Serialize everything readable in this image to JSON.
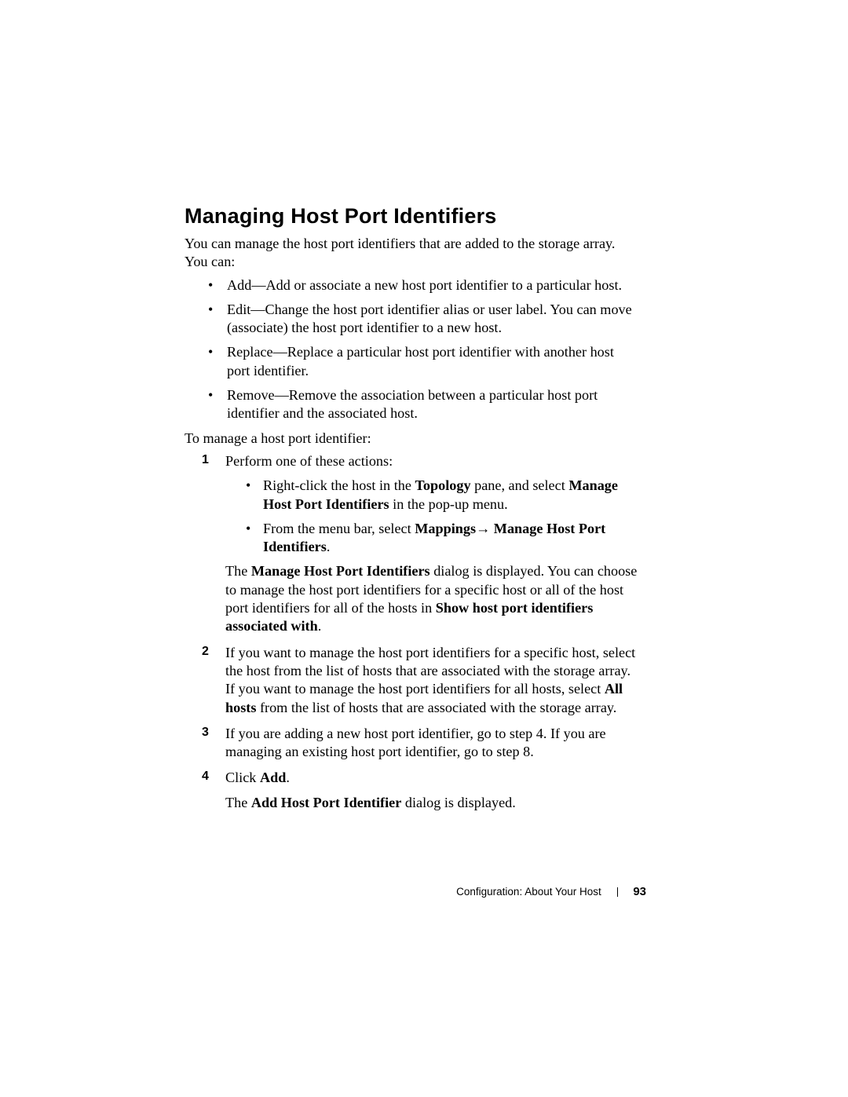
{
  "heading": "Managing Host Port Identifiers",
  "intro": "You can manage the host port identifiers that are added to the storage array. You can:",
  "bullets": [
    "Add—Add or associate a new host port identifier to a particular host.",
    "Edit—Change the host port identifier alias or user label. You can move (associate) the host port identifier to a new host.",
    "Replace—Replace a particular host port identifier with another host port identifier.",
    "Remove—Remove the association between a particular host port identifier and the associated host."
  ],
  "lead2": "To manage a host port identifier:",
  "steps": {
    "s1": {
      "num": "1",
      "text": "Perform one of these actions:",
      "sub_a_pre": "Right-click the host in the ",
      "sub_a_b1": "Topology",
      "sub_a_mid": " pane, and select ",
      "sub_a_b2": "Manage Host Port Identifiers",
      "sub_a_post": " in the pop-up menu.",
      "sub_b_pre": "From the menu bar, select ",
      "sub_b_b1": "Mappings",
      "sub_b_arrow": "→ ",
      "sub_b_b2": "Manage Host Port Identifiers",
      "sub_b_post": ".",
      "para_pre": "The ",
      "para_b1": "Manage Host Port Identifiers",
      "para_mid": " dialog is displayed. You can choose to manage the host port identifiers for a specific host or all of the host port identifiers for all of the hosts in ",
      "para_b2": "Show host port identifiers associated with",
      "para_post": "."
    },
    "s2": {
      "num": "2",
      "pre": "If you want to manage the host port identifiers for a specific host, select the host from the list of hosts that are associated with the storage array. If you want to manage the host port identifiers for all hosts, select ",
      "b1": "All hosts",
      "post": " from the list of hosts that are associated with the storage array."
    },
    "s3": {
      "num": "3",
      "text": "If you are adding a new host port identifier, go to step 4. If you are managing an existing host port identifier, go to step 8."
    },
    "s4": {
      "num": "4",
      "pre": "Click ",
      "b1": "Add",
      "post": ".",
      "para_pre": "The ",
      "para_b1": "Add Host Port Identifier",
      "para_post": " dialog is displayed."
    }
  },
  "footer": {
    "section": "Configuration: About Your Host",
    "page": "93"
  }
}
